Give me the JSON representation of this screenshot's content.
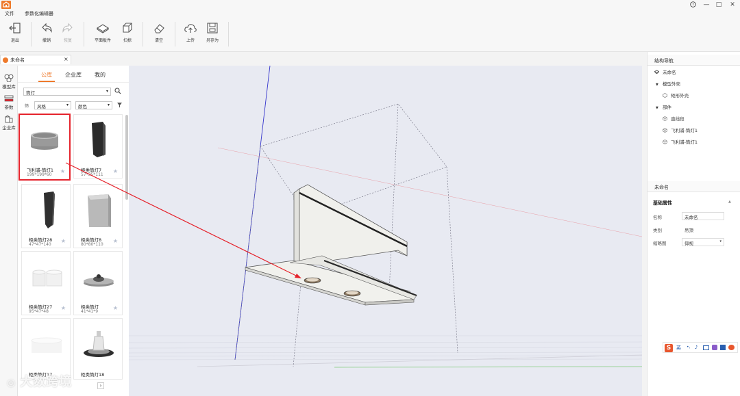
{
  "menubar": {
    "file": "文件",
    "editor": "参数化编辑器"
  },
  "window_controls": {
    "help": "?",
    "minimize": "—",
    "maximize": "□",
    "close": "✕"
  },
  "toolbar": {
    "exit": "退出",
    "undo": "撤销",
    "redo": "恢复",
    "flat_panel": "平面板件",
    "sweep": "扫掠",
    "clear": "清空",
    "upload": "上传",
    "save_as": "另存为"
  },
  "doc_tab": {
    "label": "未命名",
    "close": "×"
  },
  "side_tabs": {
    "model_lib": "模型库",
    "params": "参数",
    "enterprise_lib": "企业库"
  },
  "library": {
    "tabs": {
      "public": "公库",
      "enterprise": "企业库",
      "mine": "我的"
    },
    "category": "筒灯",
    "filter_prefix": "筛",
    "style_filter": "风格",
    "color_filter": "颜色",
    "items": [
      {
        "name": "飞利浦-筒灯1",
        "dims": "199*199*60"
      },
      {
        "name": "柜类筒灯7",
        "dims": "57*35*111"
      },
      {
        "name": "柜类筒灯28",
        "dims": "47*47*140"
      },
      {
        "name": "柜类筒灯8",
        "dims": "80*80*110"
      },
      {
        "name": "柜类筒灯27",
        "dims": "95*47*48"
      },
      {
        "name": "柜类筒灯",
        "dims": "41*41*9"
      },
      {
        "name": "柜类筒灯17",
        "dims": ""
      },
      {
        "name": "柜类筒灯18",
        "dims": ""
      }
    ]
  },
  "structure_nav": {
    "title": "结构导航",
    "root": "未命名",
    "model_shape": "模型外壳",
    "rect_shape": "矩形外壳",
    "parts": "部件",
    "line_segment": "直线段",
    "part1": "飞利浦-筒灯1",
    "part2": "飞利浦-筒灯1"
  },
  "properties": {
    "panel_title": "未命名",
    "section": "基础属性",
    "name_label": "名称",
    "name_value": "未命名",
    "category_label": "类别",
    "category_value": "吊顶",
    "thumb_label": "缩略图",
    "thumb_value": "仰视"
  },
  "ime": {
    "lang": "英"
  },
  "watermark": "大数跨境",
  "colors": {
    "accent": "#ee7a2c",
    "highlight_box": "#e5232c",
    "axis_blue": "#3333cc",
    "arrow": "#e5232c"
  }
}
